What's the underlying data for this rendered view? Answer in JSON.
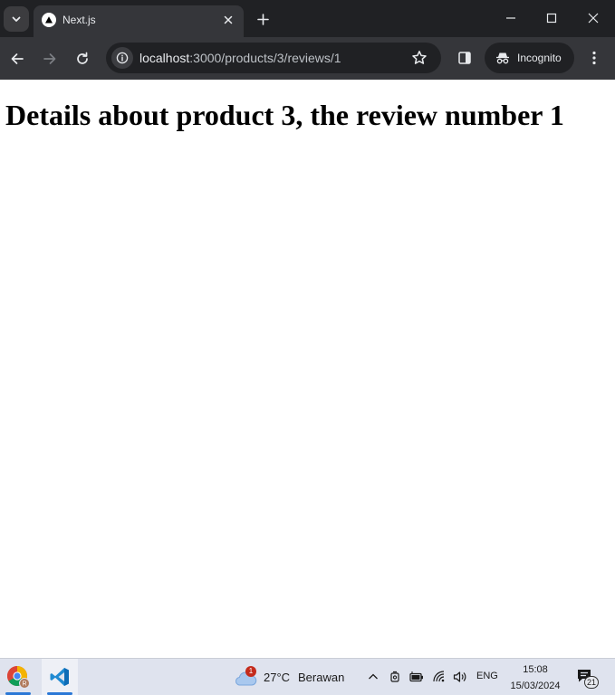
{
  "browser": {
    "tab": {
      "title": "Next.js"
    },
    "address_bar": {
      "url_host": "localhost",
      "url_rest": ":3000/products/3/reviews/1"
    },
    "profile_chip": {
      "label": "Incognito"
    },
    "icons": {
      "tab_search": "chevron-down-icon",
      "favicon": "nextjs-triangle-icon",
      "tab_close": "close-icon",
      "new_tab": "plus-icon",
      "minimize": "minimize-icon",
      "maximize": "maximize-icon",
      "close_window": "close-icon",
      "back": "arrow-left-icon",
      "forward": "arrow-right-icon",
      "reload": "reload-icon",
      "site_info": "info-icon",
      "bookmark": "star-icon",
      "side_panel": "side-panel-icon",
      "incognito": "incognito-icon",
      "menu": "kebab-menu-icon"
    },
    "colors": {
      "tabstrip": "#202124",
      "toolbar": "#35363a",
      "omnibox": "#202124",
      "text": "#e8eaed"
    }
  },
  "page": {
    "heading": "Details about product 3, the review number 1",
    "background": "#ffffff"
  },
  "taskbar": {
    "weather": {
      "badge": "1",
      "temperature": "27°C",
      "condition": "Berawan"
    },
    "tray": {
      "language": "ENG",
      "time": "15:08",
      "date": "15/03/2024",
      "notification_count": "21"
    },
    "apps": [
      "chrome",
      "visual-studio-code"
    ],
    "colors": {
      "background": "#dfe3ee",
      "active_underline": "#2b78d6"
    }
  }
}
